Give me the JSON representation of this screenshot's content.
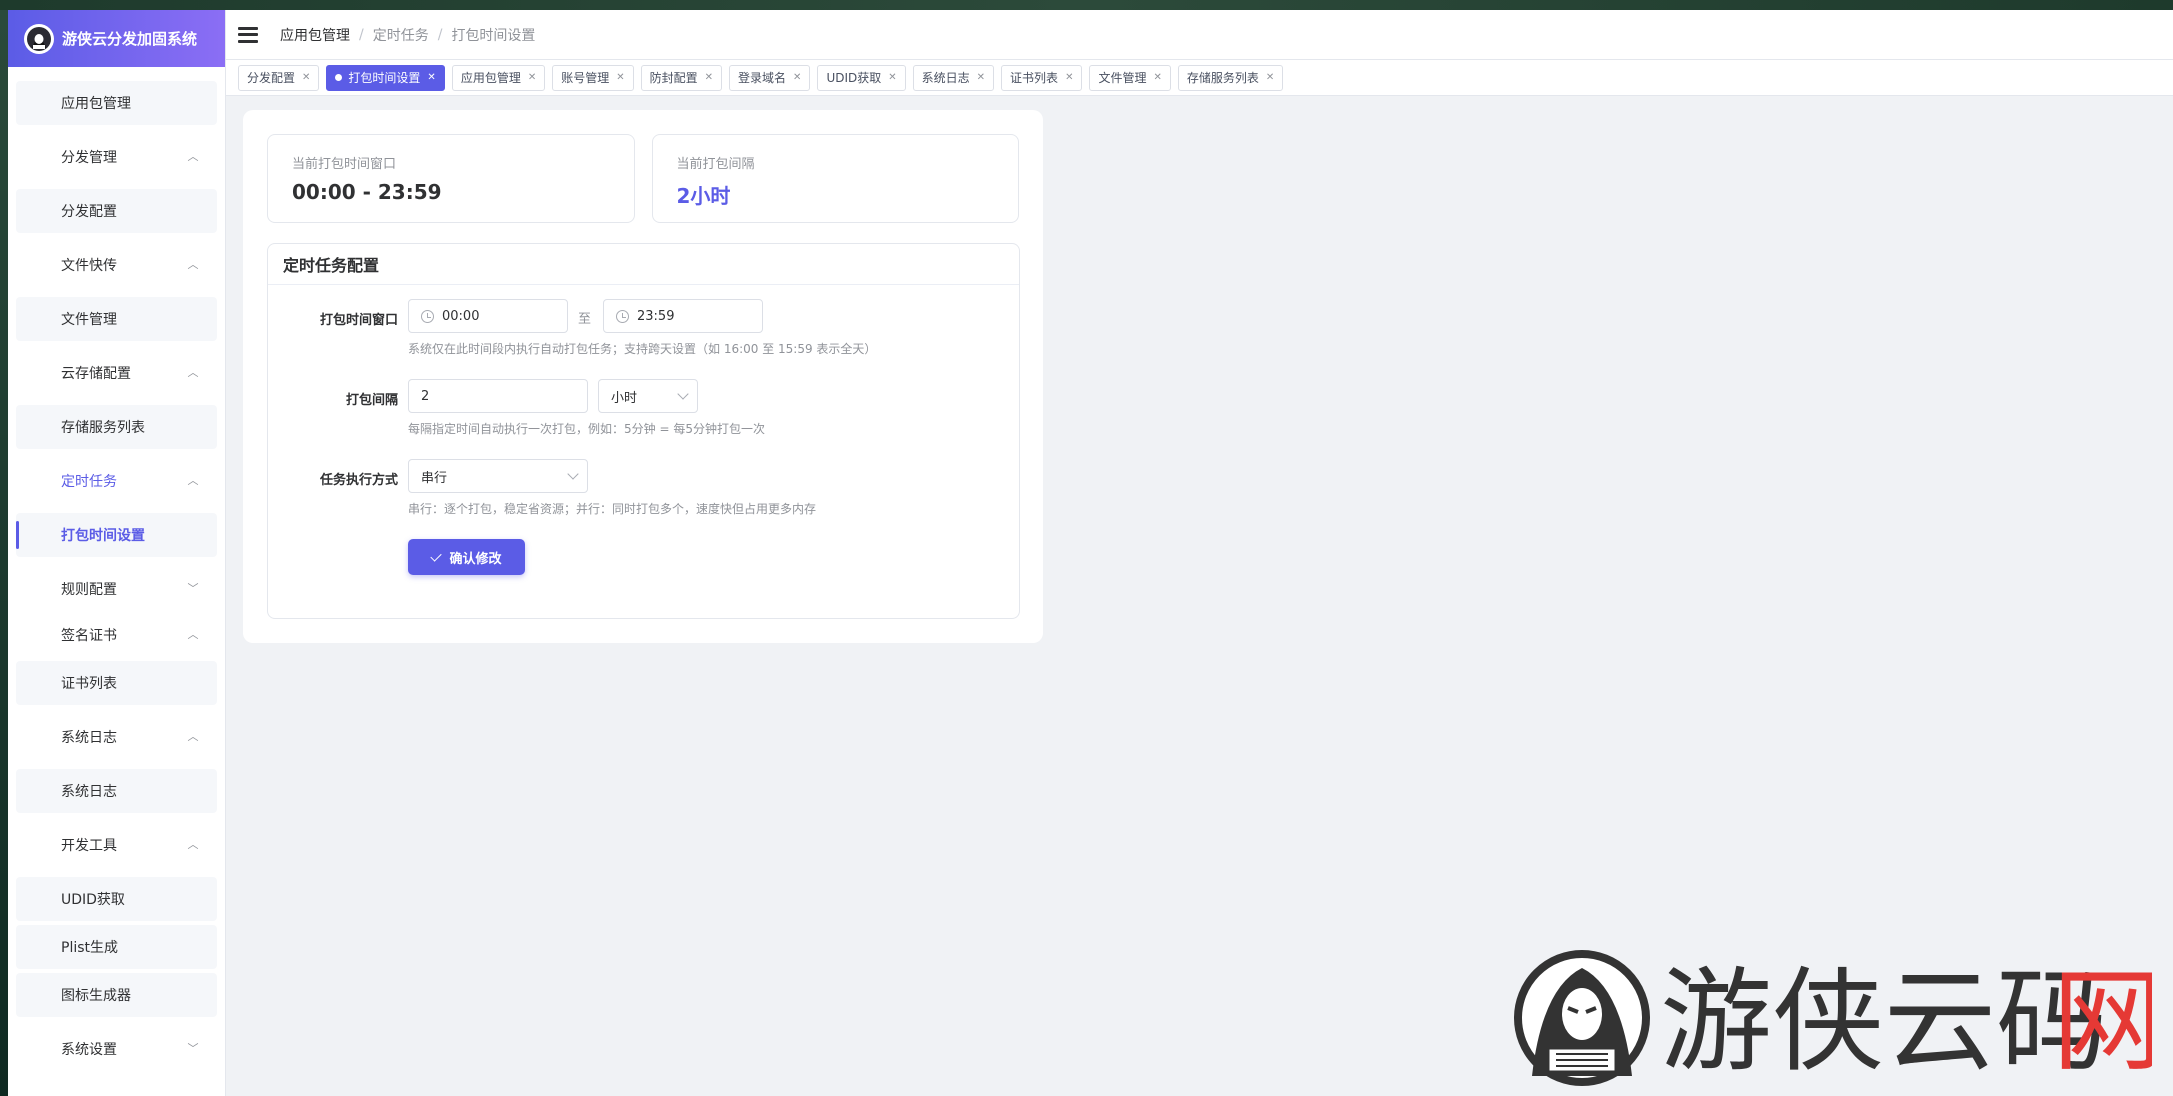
{
  "brand": {
    "title": "游侠云分发加固系统",
    "logo_icon": "hacker-hood-icon"
  },
  "sidebar": {
    "items": [
      {
        "label": "应用包管理",
        "kind": "child"
      },
      {
        "label": "分发管理",
        "kind": "parent",
        "chevron": "up"
      },
      {
        "label": "分发配置",
        "kind": "child"
      },
      {
        "label": "文件快传",
        "kind": "parent",
        "chevron": "up"
      },
      {
        "label": "文件管理",
        "kind": "child"
      },
      {
        "label": "云存储配置",
        "kind": "parent",
        "chevron": "up"
      },
      {
        "label": "存储服务列表",
        "kind": "child"
      },
      {
        "label": "定时任务",
        "kind": "parent",
        "chevron": "up",
        "active": true
      },
      {
        "label": "打包时间设置",
        "kind": "child",
        "active": true
      },
      {
        "label": "规则配置",
        "kind": "parent",
        "chevron": "down"
      },
      {
        "label": "签名证书",
        "kind": "parent",
        "chevron": "up"
      },
      {
        "label": "证书列表",
        "kind": "child"
      },
      {
        "label": "系统日志",
        "kind": "parent",
        "chevron": "up"
      },
      {
        "label": "系统日志",
        "kind": "child"
      },
      {
        "label": "开发工具",
        "kind": "parent",
        "chevron": "up"
      },
      {
        "label": "UDID获取",
        "kind": "child"
      },
      {
        "label": "Plist生成",
        "kind": "child"
      },
      {
        "label": "图标生成器",
        "kind": "child"
      },
      {
        "label": "系统设置",
        "kind": "parent",
        "chevron": "down"
      }
    ]
  },
  "breadcrumb": [
    "应用包管理",
    "定时任务",
    "打包时间设置"
  ],
  "tags": [
    {
      "label": "分发配置"
    },
    {
      "label": "打包时间设置",
      "active": true
    },
    {
      "label": "应用包管理"
    },
    {
      "label": "账号管理"
    },
    {
      "label": "防封配置"
    },
    {
      "label": "登录域名"
    },
    {
      "label": "UDID获取"
    },
    {
      "label": "系统日志"
    },
    {
      "label": "证书列表"
    },
    {
      "label": "文件管理"
    },
    {
      "label": "存储服务列表"
    }
  ],
  "stats": {
    "window_label": "当前打包时间窗口",
    "window_value": "00:00 - 23:59",
    "interval_label": "当前打包间隔",
    "interval_value": "2小时"
  },
  "form": {
    "title": "定时任务配置",
    "window_label": "打包时间窗口",
    "start_time": "00:00",
    "to_text": "至",
    "end_time": "23:59",
    "window_hint": "系统仅在此时间段内执行自动打包任务；支持跨天设置（如 16:00 至 15:59 表示全天）",
    "interval_label": "打包间隔",
    "interval_value": "2",
    "interval_unit": "小时",
    "interval_hint": "每隔指定时间自动执行一次打包，例如：5分钟 = 每5分钟打包一次",
    "mode_label": "任务执行方式",
    "mode_value": "串行",
    "mode_hint": "串行：逐个打包，稳定省资源；并行：同时打包多个，速度快但占用更多内存",
    "submit_label": "确认修改"
  },
  "watermark": {
    "text_main": "游侠云码",
    "text_accent": "网"
  },
  "colors": {
    "accent": "#5b5ce6",
    "watermark_red": "#e53935"
  }
}
